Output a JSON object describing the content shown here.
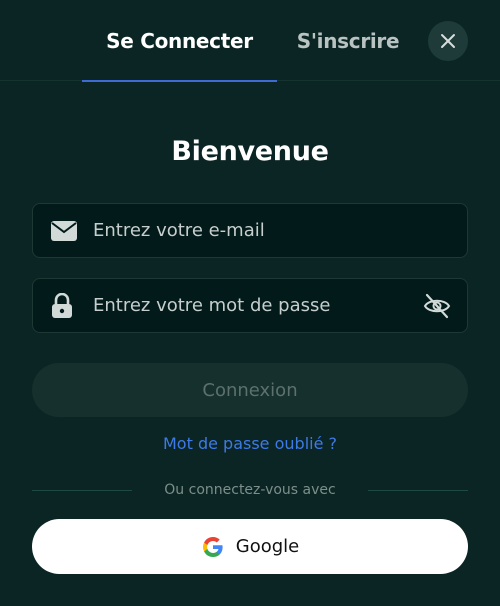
{
  "tabs": {
    "login": "Se Connecter",
    "signup": "S'inscrire"
  },
  "title": "Bienvenue",
  "form": {
    "email_placeholder": "Entrez votre e-mail",
    "password_placeholder": "Entrez votre mot de passe",
    "submit_label": "Connexion",
    "forgot_label": "Mot de passe oublié ?"
  },
  "divider_text": "Ou connectez-vous avec",
  "social": {
    "google_label": "Google"
  },
  "icons": {
    "close": "close-icon",
    "email": "envelope-icon",
    "password": "lock-icon",
    "toggle_visibility": "eye-off-icon",
    "google": "google-logo-icon"
  },
  "colors": {
    "background": "#0b2524",
    "accent": "#3c6bd4",
    "link": "#3e7ae6",
    "input_bg": "#021a19",
    "submit_disabled_bg": "#16302e"
  }
}
